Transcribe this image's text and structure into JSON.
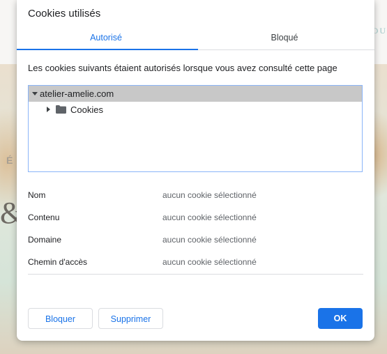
{
  "background": {
    "top_right_text": "BOU",
    "letter_e": "É",
    "ampersand": "&"
  },
  "dialog": {
    "title": "Cookies utilisés",
    "tabs": [
      {
        "label": "Autorisé",
        "selected": true
      },
      {
        "label": "Bloqué",
        "selected": false
      }
    ],
    "description": "Les cookies suivants étaient autorisés lorsque vous avez consulté cette page",
    "tree": {
      "root": {
        "label": "atelier-amelie.com",
        "expanded": true,
        "selected": true
      },
      "children": [
        {
          "label": "Cookies",
          "expanded": false,
          "icon": "folder-icon"
        }
      ]
    },
    "details": [
      {
        "label": "Nom",
        "value": "aucun cookie sélectionné"
      },
      {
        "label": "Contenu",
        "value": "aucun cookie sélectionné"
      },
      {
        "label": "Domaine",
        "value": "aucun cookie sélectionné"
      },
      {
        "label": "Chemin d'accès",
        "value": "aucun cookie sélectionné"
      }
    ],
    "buttons": {
      "block": "Bloquer",
      "delete": "Supprimer",
      "ok": "OK"
    }
  },
  "colors": {
    "accent": "#1a73e8",
    "selection": "#c8c8c8",
    "tree_border": "#8ab4f8"
  }
}
